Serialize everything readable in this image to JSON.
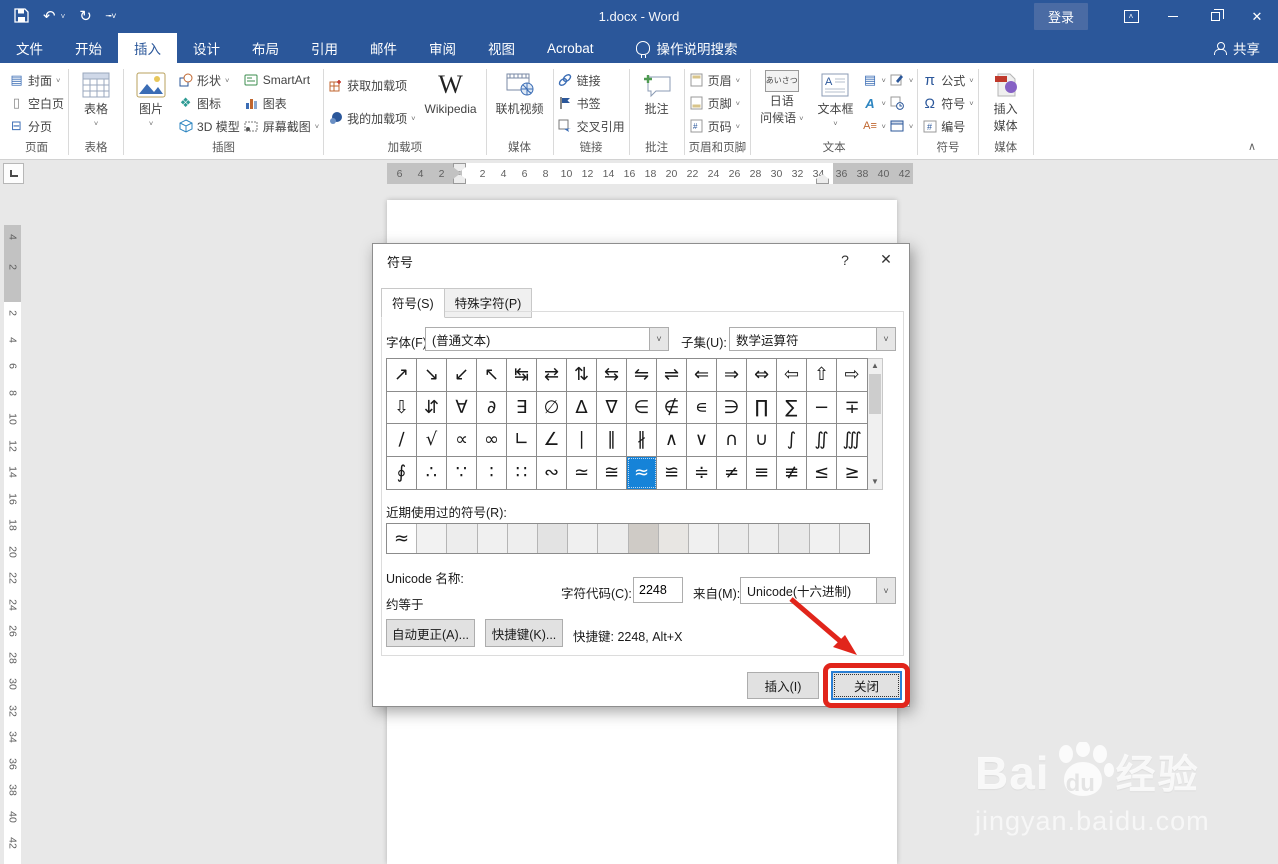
{
  "titlebar": {
    "title": "1.docx  -  Word",
    "login": "登录"
  },
  "tabs": {
    "items": [
      "文件",
      "开始",
      "插入",
      "设计",
      "布局",
      "引用",
      "邮件",
      "审阅",
      "视图",
      "Acrobat"
    ],
    "active_index": 2,
    "search": "操作说明搜索",
    "share": "共享"
  },
  "ribbon": {
    "pages": {
      "cover": "封面",
      "blank": "空白页",
      "break": "分页",
      "label": "页面"
    },
    "tables": {
      "table": "表格",
      "label": "表格"
    },
    "illustrations": {
      "pictures": "图片",
      "shapes": "形状",
      "icons": "图标",
      "model3d": "3D 模型",
      "smartart": "SmartArt",
      "chart": "图表",
      "screenshot": "屏幕截图",
      "label": "插图"
    },
    "addins": {
      "get": "获取加载项",
      "my": "我的加载项",
      "wikipedia": "Wikipedia",
      "label": "加载项"
    },
    "media1": {
      "video": "联机视频",
      "label": "媒体"
    },
    "links": {
      "link": "链接",
      "bookmark": "书签",
      "crossref": "交叉引用",
      "label": "链接"
    },
    "comments": {
      "comment": "批注",
      "label": "批注"
    },
    "headerfooter": {
      "header": "页眉",
      "footer": "页脚",
      "pagenum": "页码",
      "label": "页眉和页脚"
    },
    "text": {
      "japanese_l1": "日语",
      "japanese_l2": "问候语",
      "textbox": "文本框",
      "label": "文本"
    },
    "symbols": {
      "equation": "公式",
      "symbol": "符号",
      "number": "编号",
      "label": "符号",
      "pi": "π",
      "omega": "Ω"
    },
    "media2": {
      "l1": "插入",
      "l2": "媒体",
      "label": "媒体"
    }
  },
  "ruler": {
    "h_gray_left": [
      "6",
      "4",
      "2"
    ],
    "h_white": [
      "2",
      "4",
      "6",
      "8",
      "10",
      "12",
      "14",
      "16",
      "18",
      "20",
      "22",
      "24",
      "26",
      "28",
      "30",
      "32",
      "34"
    ],
    "h_gray_right": [
      "36",
      "38",
      "40",
      "42"
    ],
    "v_gray": [
      "4",
      "2"
    ],
    "v_white": [
      "2",
      "4",
      "6",
      "8",
      "10",
      "12",
      "14",
      "16",
      "18",
      "20",
      "22",
      "24",
      "26",
      "28",
      "30",
      "32",
      "34",
      "36",
      "38",
      "40",
      "42"
    ]
  },
  "dialog": {
    "title": "符号",
    "help_glyph": "?",
    "close_glyph": "✕",
    "tab_symbols": "符号(S)",
    "tab_special": "特殊字符(P)",
    "font_label": "字体(F):",
    "font_value": "(普通文本)",
    "subset_label": "子集(U):",
    "subset_value": "数学运算符",
    "grid_rows": [
      [
        "↗",
        "↘",
        "↙",
        "↖",
        "↹",
        "⇄",
        "⇅",
        "⇆",
        "⇋",
        "⇌",
        "⇐",
        "⇒",
        "⇔",
        "⇦",
        "⇧",
        "⇨"
      ],
      [
        "⇩",
        "⇵",
        "∀",
        "∂",
        "∃",
        "∅",
        "∆",
        "∇",
        "∈",
        "∉",
        "∊",
        "∋",
        "∏",
        "∑",
        "−",
        "∓"
      ],
      [
        "∕",
        "√",
        "∝",
        "∞",
        "∟",
        "∠",
        "∣",
        "∥",
        "∦",
        "∧",
        "∨",
        "∩",
        "∪",
        "∫",
        "∬",
        "∭"
      ],
      [
        "∮",
        "∴",
        "∵",
        "∶",
        "∷",
        "∾",
        "≃",
        "≅",
        "≈",
        "≌",
        "≑",
        "≠",
        "≡",
        "≢",
        "≤",
        "≥"
      ]
    ],
    "selected": {
      "row": 3,
      "col": 8,
      "symbol": "≈"
    },
    "recent_label": "近期使用过的符号(R):",
    "recent_first": "≈",
    "recent_blur": [
      "#f2f2f2",
      "#ededed",
      "#f0f0f0",
      "#eeeeee",
      "#e3e3e3",
      "#f0f0f0",
      "#ededed",
      "#cfcbc6",
      "#e8e6e3",
      "#f0f0f0",
      "#ebebeb",
      "#eeeeee",
      "#e9e9e9",
      "#f1f1f1",
      "#efefef"
    ],
    "unicode_label": "Unicode 名称:",
    "unicode_name": "约等于",
    "charcode_label": "字符代码(C):",
    "charcode_value": "2248",
    "from_label": "来自(M):",
    "from_value": "Unicode(十六进制)",
    "autocorrect_btn": "自动更正(A)...",
    "shortcut_btn": "快捷键(K)...",
    "shortcut_text": "快捷键: 2248, Alt+X",
    "insert_btn": "插入(I)",
    "close_btn": "关闭",
    "annotation_color": "#e1251b"
  },
  "watermark": {
    "bai": "Bai",
    "du": "du",
    "cn": "经验",
    "url": "jingyan.baidu.com"
  }
}
